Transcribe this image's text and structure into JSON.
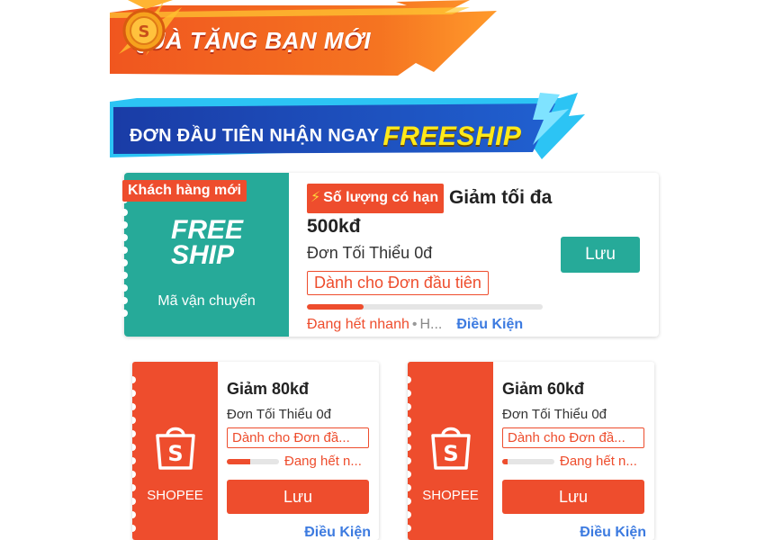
{
  "banner_new_user": {
    "text": "QUÀ TẶNG BẠN MỚI"
  },
  "banner_freeship": {
    "text": "ĐƠN ĐẦU TIÊN NHẬN NGAY",
    "highlight": "FREESHIP"
  },
  "freeship_voucher": {
    "badge": "Khách hàng mới",
    "logo_line1": "FREE",
    "logo_line2": "SHIP",
    "subtitle": "Mã vận chuyển",
    "limited_label": "Số lượng có hạn",
    "title": "Giảm tối đa 500kđ",
    "min_order": "Đơn Tối Thiểu 0đ",
    "tag": "Dành cho Đơn đầu tiên",
    "progress_percent": 24,
    "status": "Đang hết nhanh",
    "status_extra": "H...",
    "conditions": "Điều Kiện",
    "save_button": "Lưu",
    "color": "#26aa99"
  },
  "shopee_vouchers": [
    {
      "brand": "SHOPEE",
      "title": "Giảm 80kđ",
      "min_order": "Đơn Tối Thiểu 0đ",
      "tag": "Dành cho Đơn đầ...",
      "progress_percent": 45,
      "status": "Đang hết n...",
      "save_button": "Lưu",
      "conditions": "Điều Kiện"
    },
    {
      "brand": "SHOPEE",
      "title": "Giảm 60kđ",
      "min_order": "Đơn Tối Thiểu 0đ",
      "tag": "Dành cho Đơn đầ...",
      "progress_percent": 10,
      "status": "Đang hết n...",
      "save_button": "Lưu",
      "conditions": "Điều Kiện"
    }
  ],
  "colors": {
    "shopee_orange": "#ee4d2d",
    "teal": "#26aa99",
    "link_blue": "#3d7be0",
    "banner_blue": "#1b3fa8"
  },
  "icons": [
    "coin-icon",
    "lightning-icon",
    "shopping-bag-icon"
  ]
}
